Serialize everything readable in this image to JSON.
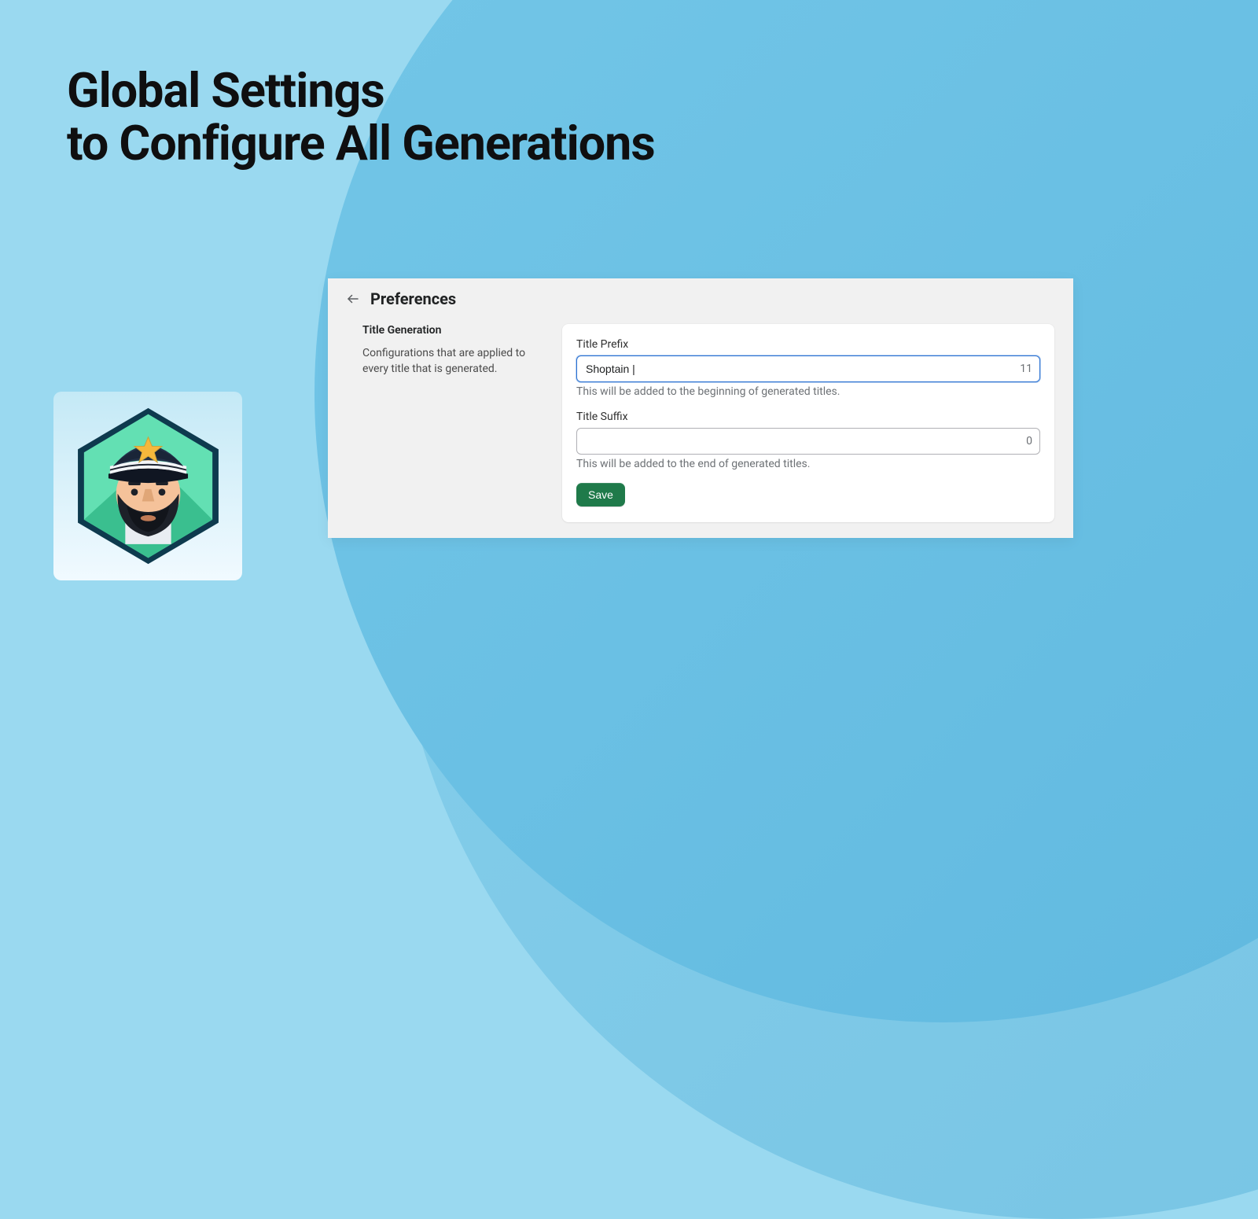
{
  "hero": {
    "line1": "Global Settings",
    "line2": "to Configure All Generations"
  },
  "panel": {
    "title": "Preferences",
    "section": {
      "heading": "Title Generation",
      "description": "Configurations that are applied to every title that is generated."
    },
    "fields": {
      "prefix": {
        "label": "Title Prefix",
        "value": "Shoptain | ",
        "count": "11",
        "help": "This will be added to the beginning of generated titles."
      },
      "suffix": {
        "label": "Title Suffix",
        "value": "",
        "count": "0",
        "help": "This will be added to the end of generated titles."
      }
    },
    "save_label": "Save"
  }
}
